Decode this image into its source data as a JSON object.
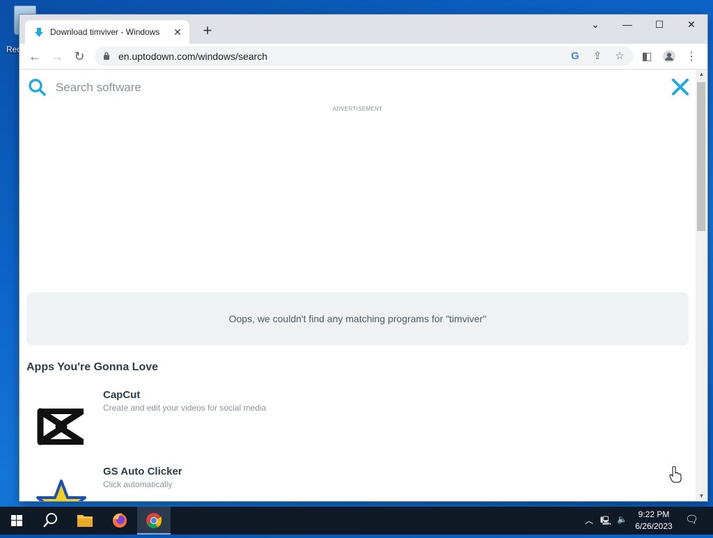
{
  "desktop": {
    "icon_label": "Rec"
  },
  "browser": {
    "tab_title": "Download timviver - Windows",
    "new_tab_glyph": "+",
    "url": "en.uptodown.com/windows/search",
    "window_controls": {
      "dropdown": "⌄",
      "minimize": "—",
      "maximize": "☐",
      "close": "✕"
    }
  },
  "page": {
    "search": {
      "placeholder": "Search software",
      "value": ""
    },
    "advertisement_label": "ADVERTISEMENT",
    "no_results_message": "Oops, we couldn't find any matching programs for \"timviver\"",
    "section_title": "Apps You're Gonna Love",
    "apps": [
      {
        "name": "CapCut",
        "description": "Create and edit your videos for social media",
        "icon": "capcut-logo"
      },
      {
        "name": "GS Auto Clicker",
        "description": "Click automatically",
        "icon": "star-logo"
      }
    ]
  },
  "taskbar": {
    "clock_time": "9:22 PM",
    "clock_date": "6/26/2023",
    "items": [
      "start-icon",
      "search-icon",
      "file-explorer-icon",
      "firefox-icon",
      "chrome-icon"
    ]
  },
  "colors": {
    "accent": "#1fa9e1",
    "nomatch_bg": "#eef2f3",
    "taskbar": "#101a26"
  }
}
